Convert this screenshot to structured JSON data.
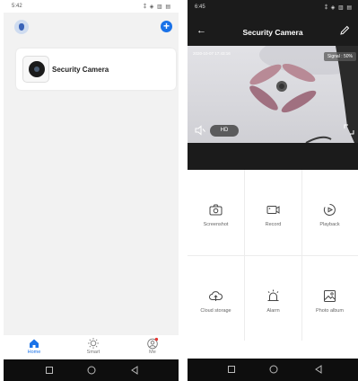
{
  "left": {
    "status": {
      "time": "5:42",
      "icons": "⁞ ☁ ✉ ▣ •",
      "right_icons": "⁑ ◈ ▥ ▤"
    },
    "device_card": {
      "name": "Security Camera"
    },
    "tabs": [
      {
        "label": "Home",
        "active": true,
        "icon": "home-icon"
      },
      {
        "label": "Smart",
        "active": false,
        "icon": "sun-icon"
      },
      {
        "label": "Me",
        "active": false,
        "icon": "profile-icon"
      }
    ]
  },
  "right": {
    "status": {
      "time": "6:45",
      "icons": "▤ ◉ ▥ ◉ •",
      "right_icons": "⁑ ◈ ▥ ▤"
    },
    "title": "Security Camera",
    "video": {
      "overlay_text": "2020-10-07  17:43:16",
      "signal": "Signal : 50%",
      "quality": "HD"
    },
    "actions": [
      {
        "label": "Screenshot",
        "icon": "camera-icon"
      },
      {
        "label": "Record",
        "icon": "video-record-icon"
      },
      {
        "label": "Playback",
        "icon": "playback-icon"
      },
      {
        "label": "Cloud storage",
        "icon": "cloud-icon"
      },
      {
        "label": "Alarm",
        "icon": "alarm-icon"
      },
      {
        "label": "Photo album",
        "icon": "photo-album-icon"
      }
    ]
  },
  "colors": {
    "accent": "#1a72e8",
    "dark": "#1b1b1b",
    "background": "#f2f2f2"
  }
}
